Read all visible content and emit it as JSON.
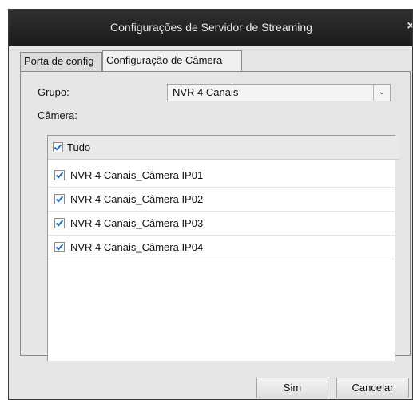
{
  "window": {
    "title": "Configurações de Servidor de Streaming",
    "close_glyph": "×"
  },
  "tabs": [
    {
      "label": "Porta de config",
      "active": false
    },
    {
      "label": "Configuração de Câmera",
      "active": true
    }
  ],
  "form": {
    "group_label": "Grupo:",
    "group_value": "NVR 4 Canais",
    "camera_label": "Câmera:"
  },
  "camera_list": {
    "header": {
      "label": "Tudo",
      "checked": true
    },
    "items": [
      {
        "label": "NVR 4 Canais_Câmera IP01",
        "checked": true
      },
      {
        "label": "NVR 4 Canais_Câmera IP02",
        "checked": true
      },
      {
        "label": "NVR 4 Canais_Câmera IP03",
        "checked": true
      },
      {
        "label": "NVR 4 Canais_Câmera IP04",
        "checked": true
      }
    ]
  },
  "buttons": {
    "ok_label": "Sim",
    "cancel_label": "Cancelar"
  },
  "colors": {
    "titlebar": "#222222",
    "checkmark": "#1f6fc4"
  }
}
